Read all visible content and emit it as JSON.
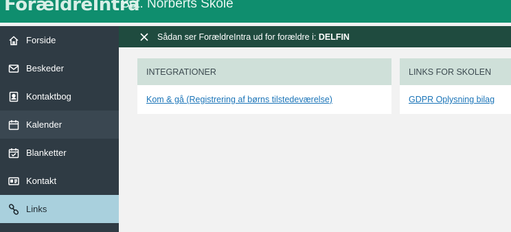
{
  "header": {
    "logo": "ForældreIntra",
    "school": "Sct. Norberts Skole"
  },
  "sidebar": {
    "items": [
      {
        "label": "Forside",
        "icon": "home-icon"
      },
      {
        "label": "Beskeder",
        "icon": "mail-icon"
      },
      {
        "label": "Kontaktbog",
        "icon": "contact-book-icon"
      },
      {
        "label": "Kalender",
        "icon": "calendar-icon"
      },
      {
        "label": "Blanketter",
        "icon": "form-calendar-check-icon"
      },
      {
        "label": "Kontakt",
        "icon": "id-card-icon"
      },
      {
        "label": "Links",
        "icon": "link-icon"
      }
    ],
    "active_index": 3,
    "selected_index": 6
  },
  "banner": {
    "text": "Sådan ser ForældreIntra ud for forældre i: ",
    "class_name": "DELFIN",
    "close_icon": "close-icon"
  },
  "panels": [
    {
      "title": "INTEGRATIONER",
      "link": "Kom & gå (Registrering af børns tilstedeværelse)"
    },
    {
      "title": "LINKS FOR SKOLEN",
      "link": "GDPR Oplysning bilag"
    }
  ],
  "colors": {
    "topbar": "#0f8e6e",
    "sidebar": "#2f3b44",
    "sidebar_selected": "#a9d0dd",
    "banner": "#1f4b3f",
    "panel_header": "#cfe0d9",
    "link": "#1a74b8"
  }
}
